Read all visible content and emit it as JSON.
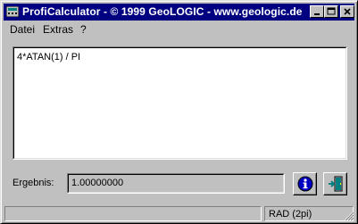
{
  "window": {
    "title": "ProfiCalculator - © 1999 GeoLOGIC - www.geologic.de"
  },
  "menu": {
    "items": [
      {
        "label": "Datei"
      },
      {
        "label": "Extras"
      },
      {
        "label": "?"
      }
    ]
  },
  "editor": {
    "expression": "4*ATAN(1) / PI"
  },
  "result": {
    "label": "Ergebnis:",
    "value": "1.00000000"
  },
  "buttons": {
    "info_icon": "info-icon",
    "exit_icon": "exit-icon"
  },
  "status": {
    "left": "",
    "mode": "RAD (2pi)"
  },
  "colors": {
    "titlebar": "#000080",
    "face": "#c0c0c0",
    "info_blue": "#0000c0",
    "exit_teal": "#008080"
  }
}
